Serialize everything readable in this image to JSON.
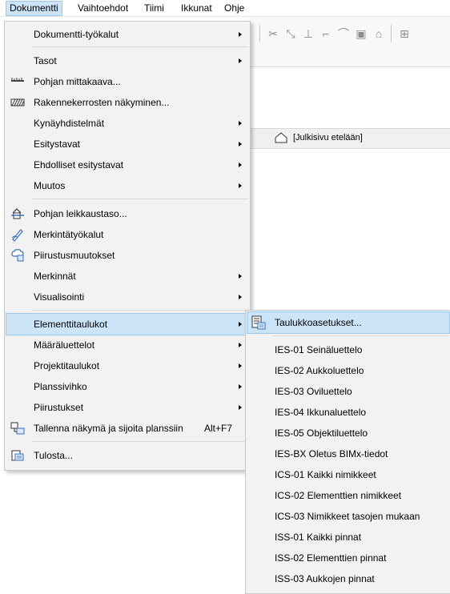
{
  "menubar": {
    "items": [
      {
        "label": "Dokumentti",
        "active": true
      },
      {
        "label": "Vaihtoehdot"
      },
      {
        "label": "Tiimi"
      },
      {
        "label": "Ikkunat"
      },
      {
        "label": "Ohje"
      }
    ]
  },
  "view_tab": {
    "label": "[Julkisivu etelään]",
    "icon": "house-icon"
  },
  "main_menu": {
    "items": [
      {
        "label": "Dokumentti-työkalut",
        "submenu": true
      },
      {
        "label": "Tasot",
        "submenu": true
      },
      {
        "label": "Pohjan mittakaava...",
        "icon": "scale-ruler-icon"
      },
      {
        "label": "Rakennekerrosten näkyminen...",
        "icon": "hatch-pattern-icon"
      },
      {
        "label": "Kynäyhdistelmät",
        "submenu": true
      },
      {
        "label": "Esitystavat",
        "submenu": true
      },
      {
        "label": "Ehdolliset esitystavat",
        "submenu": true
      },
      {
        "label": "Muutos",
        "submenu": true
      },
      {
        "label": "Pohjan leikkaustaso...",
        "icon": "cut-plane-icon"
      },
      {
        "label": "Merkintätyökalut",
        "icon": "annotation-pen-icon"
      },
      {
        "label": "Piirustusmuutokset",
        "icon": "revision-cloud-icon"
      },
      {
        "label": "Merkinnät",
        "submenu": true
      },
      {
        "label": "Visualisointi",
        "submenu": true
      },
      {
        "label": "Elementtitaulukot",
        "submenu": true,
        "highlighted": true
      },
      {
        "label": "Määräluettelot",
        "submenu": true
      },
      {
        "label": "Projektitaulukot",
        "submenu": true
      },
      {
        "label": "Planssivihko",
        "submenu": true
      },
      {
        "label": "Piirustukset",
        "submenu": true
      },
      {
        "label": "Tallenna näkymä ja sijoita planssiin",
        "shortcut": "Alt+F7",
        "icon": "place-on-layout-icon"
      },
      {
        "label": "Tulosta...",
        "icon": "print-icon"
      }
    ]
  },
  "sub_menu": {
    "items": [
      {
        "label": "Taulukkoasetukset...",
        "icon": "schedule-settings-icon",
        "highlighted": true
      },
      {
        "label": "IES-01 Seinäluettelo"
      },
      {
        "label": "IES-02 Aukkoluettelo"
      },
      {
        "label": "IES-03 Oviluettelo"
      },
      {
        "label": "IES-04 Ikkunaluettelo"
      },
      {
        "label": "IES-05 Objektiluettelo"
      },
      {
        "label": "IES-BX Oletus BIMx-tiedot"
      },
      {
        "label": "ICS-01 Kaikki nimikkeet"
      },
      {
        "label": "ICS-02 Elementtien nimikkeet"
      },
      {
        "label": "ICS-03 Nimikkeet tasojen mukaan"
      },
      {
        "label": "ISS-01 Kaikki pinnat"
      },
      {
        "label": "ISS-02 Elementtien pinnat"
      },
      {
        "label": "ISS-03 Aukkojen pinnat"
      }
    ]
  },
  "colors": {
    "menu_bg": "#f2f2f2",
    "highlight": "#cce4f7",
    "highlight_border": "#99c9ef",
    "icon_blue": "#3a6fb5"
  }
}
